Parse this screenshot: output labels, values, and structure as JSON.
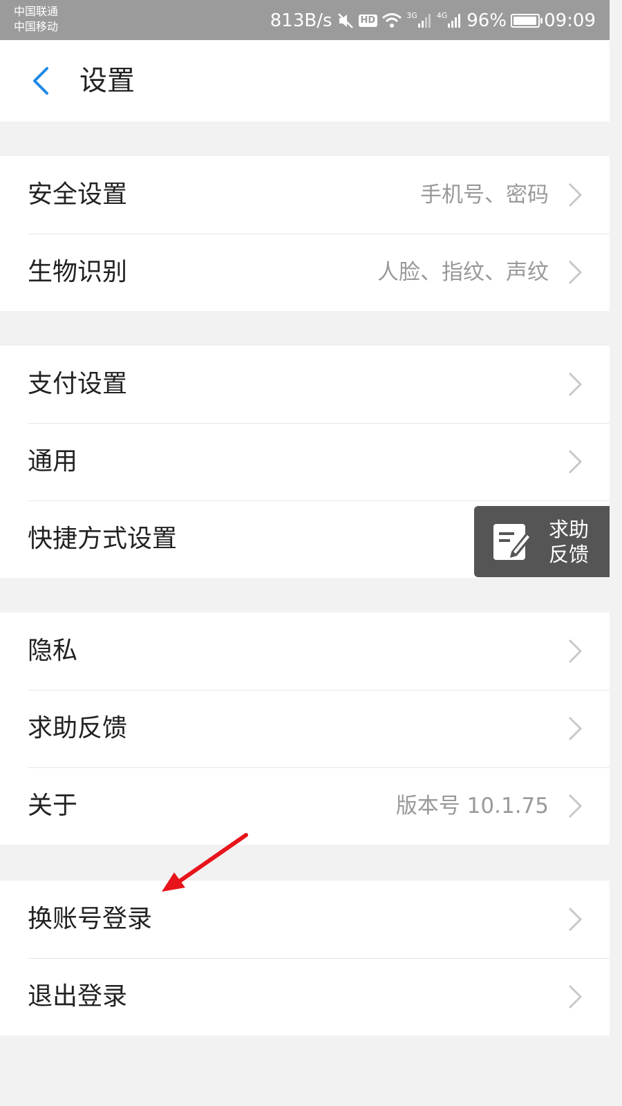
{
  "status_bar": {
    "carrier_1": "中国联通",
    "carrier_2": "中国移动",
    "network_speed": "813B/s",
    "hd_label": "HD",
    "signal_1_label": "3G",
    "signal_2_label": "4G",
    "battery_percent": "96%",
    "battery_level": 0.96,
    "time": "09:09"
  },
  "header": {
    "title": "设置"
  },
  "groups": [
    {
      "items": [
        {
          "label": "安全设置",
          "value": "手机号、密码"
        },
        {
          "label": "生物识别",
          "value": "人脸、指纹、声纹"
        }
      ]
    },
    {
      "items": [
        {
          "label": "支付设置",
          "value": ""
        },
        {
          "label": "通用",
          "value": ""
        },
        {
          "label": "快捷方式设置",
          "value": ""
        }
      ]
    },
    {
      "items": [
        {
          "label": "隐私",
          "value": ""
        },
        {
          "label": "求助反馈",
          "value": ""
        },
        {
          "label": "关于",
          "value": "版本号 10.1.75"
        }
      ]
    },
    {
      "items": [
        {
          "label": "换账号登录",
          "value": ""
        },
        {
          "label": "退出登录",
          "value": ""
        }
      ]
    }
  ],
  "floating_help": {
    "line1": "求助",
    "line2": "反馈"
  },
  "colors": {
    "accent": "#1e88e5",
    "annotation_arrow": "#e8141b"
  }
}
